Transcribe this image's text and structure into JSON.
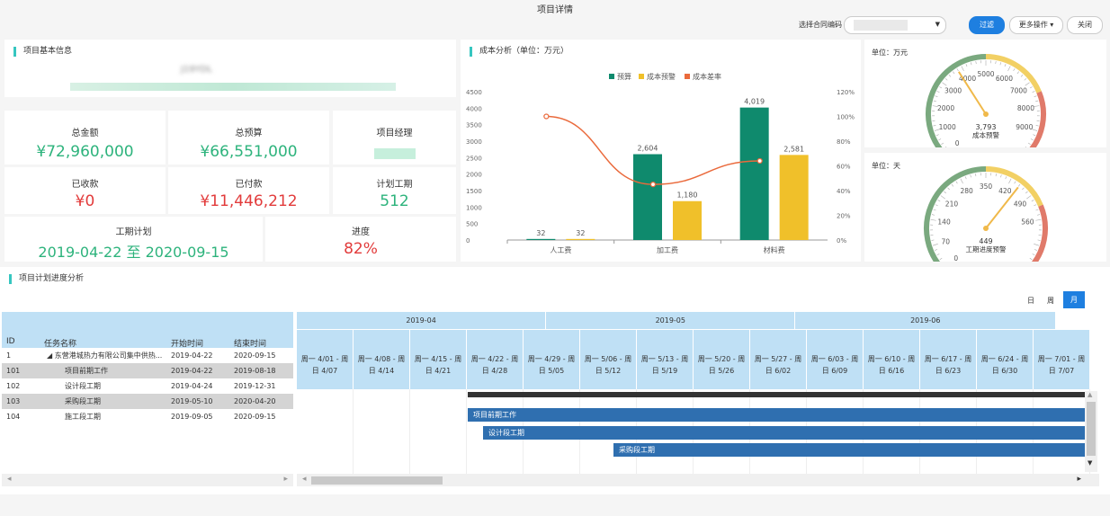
{
  "page_title": "项目详情",
  "toolbar": {
    "select_label": "选择合同编码",
    "filter_label": "过滤",
    "more_label": "更多操作 ▾",
    "close_label": "关闭"
  },
  "basic_info": {
    "title": "项目基本信息",
    "code_fragment": "J19YDL"
  },
  "stats": {
    "total_amount_label": "总金额",
    "total_amount": "¥72,960,000",
    "total_budget_label": "总预算",
    "total_budget": "¥66,551,000",
    "manager_label": "项目经理",
    "received_label": "已收款",
    "received": "¥0",
    "paid_label": "已付款",
    "paid": "¥11,446,212",
    "planned_days_label": "计划工期",
    "planned_days": "512",
    "schedule_label": "工期计划",
    "schedule": "2019-04-22 至 2020-09-15",
    "progress_label": "进度",
    "progress": "82%"
  },
  "cost_chart": {
    "title": "成本分析（单位：万元）"
  },
  "chart_data": [
    {
      "type": "bar",
      "categories": [
        "人工费",
        "加工费",
        "材料费"
      ],
      "series": [
        {
          "name": "预算",
          "values": [
            32,
            2604,
            4019
          ],
          "color": "#0f8a6d"
        },
        {
          "name": "成本预警",
          "values": [
            32,
            1180,
            2581
          ],
          "color": "#f0c02a"
        }
      ],
      "line_series": {
        "name": "成本差率",
        "values": [
          100,
          45,
          64
        ],
        "color": "#ea6a3c"
      },
      "ylim": [
        0,
        4500
      ],
      "yticks": [
        "0",
        "500",
        "1000",
        "1500",
        "2000",
        "2500",
        "3000",
        "3500",
        "4000",
        "4500"
      ],
      "y2lim": [
        0,
        120
      ],
      "y2ticks": [
        "0%",
        "20%",
        "40%",
        "60%",
        "80%",
        "100%",
        "120%"
      ],
      "legend_position": "top"
    },
    {
      "type": "gauge",
      "unit_label": "单位：万元",
      "value": 3793,
      "value_text": "3,793",
      "caption": "成本预警",
      "range": [
        0,
        10000
      ],
      "tick_labels": [
        "0",
        "1000",
        "2000",
        "3000",
        "4000",
        "5000",
        "6000",
        "7000",
        "8000",
        "9000"
      ]
    },
    {
      "type": "gauge",
      "unit_label": "单位：天",
      "value": 449,
      "value_text": "449",
      "caption": "工期进度预警",
      "range": [
        0,
        700
      ],
      "tick_labels": [
        "0",
        "70",
        "140",
        "210",
        "280",
        "350",
        "420",
        "490",
        "560"
      ]
    }
  ],
  "gantt": {
    "title": "项目计划进度分析",
    "view_day": "日",
    "view_week": "周",
    "view_month": "月",
    "columns": {
      "id": "ID",
      "name": "任务名称",
      "start": "开始时间",
      "end": "结束时间"
    },
    "rows": [
      {
        "id": "1",
        "name": "◢ 东营港城热力有限公司集中供热...",
        "start": "2019-04-22",
        "end": "2020-09-15"
      },
      {
        "id": "101",
        "name": "项目前期工作",
        "start": "2019-04-22",
        "end": "2019-08-18"
      },
      {
        "id": "102",
        "name": "设计段工期",
        "start": "2019-04-24",
        "end": "2019-12-31"
      },
      {
        "id": "103",
        "name": "采购段工期",
        "start": "2019-05-10",
        "end": "2020-04-20"
      },
      {
        "id": "104",
        "name": "施工段工期",
        "start": "2019-09-05",
        "end": "2020-09-15"
      }
    ],
    "months": [
      "2019-04",
      "2019-05",
      "2019-06"
    ],
    "weeks": [
      {
        "l1": "周一 4/01 - 周",
        "l2": "日 4/07"
      },
      {
        "l1": "周一 4/08 - 周",
        "l2": "日 4/14"
      },
      {
        "l1": "周一 4/15 - 周",
        "l2": "日 4/21"
      },
      {
        "l1": "周一 4/22 - 周",
        "l2": "日 4/28"
      },
      {
        "l1": "周一 4/29 - 周",
        "l2": "日 5/05"
      },
      {
        "l1": "周一 5/06 - 周",
        "l2": "日 5/12"
      },
      {
        "l1": "周一 5/13 - 周",
        "l2": "日 5/19"
      },
      {
        "l1": "周一 5/20 - 周",
        "l2": "日 5/26"
      },
      {
        "l1": "周一 5/27 - 周",
        "l2": "日 6/02"
      },
      {
        "l1": "周一 6/03 - 周",
        "l2": "日 6/09"
      },
      {
        "l1": "周一 6/10 - 周",
        "l2": "日 6/16"
      },
      {
        "l1": "周一 6/17 - 周",
        "l2": "日 6/23"
      },
      {
        "l1": "周一 6/24 - 周",
        "l2": "日 6/30"
      },
      {
        "l1": "周一 7/01 - 周",
        "l2": "日 7/07"
      }
    ],
    "bars": [
      "项目前期工作",
      "设计段工期",
      "采购段工期"
    ]
  }
}
